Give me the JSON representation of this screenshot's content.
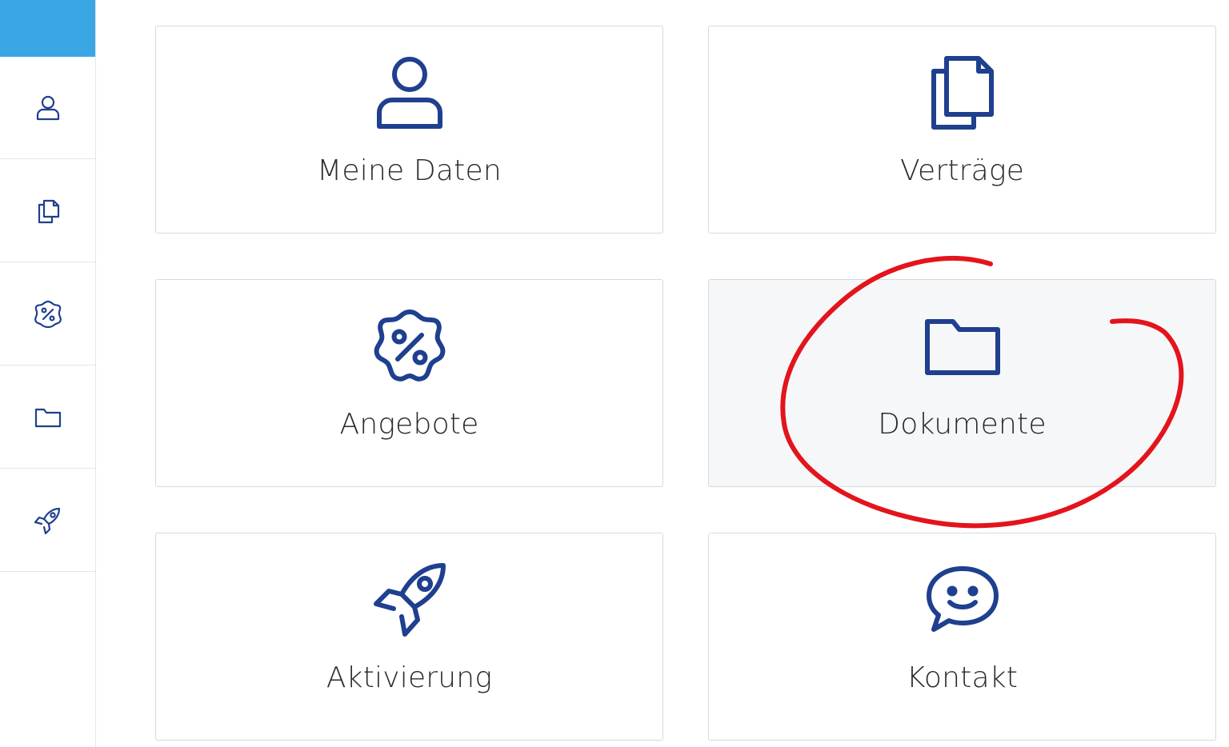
{
  "sidebar": {
    "items": [
      {
        "icon": "home-icon",
        "active": true
      },
      {
        "icon": "user-icon",
        "active": false
      },
      {
        "icon": "documents-copy-icon",
        "active": false
      },
      {
        "icon": "percent-badge-icon",
        "active": false
      },
      {
        "icon": "folder-icon",
        "active": false
      },
      {
        "icon": "rocket-icon",
        "active": false
      }
    ]
  },
  "tiles": {
    "meine_daten": {
      "label": "Meine Daten",
      "icon": "user-icon"
    },
    "vertraege": {
      "label": "Verträge",
      "icon": "documents-copy-icon"
    },
    "angebote": {
      "label": "Angebote",
      "icon": "percent-badge-icon"
    },
    "dokumente": {
      "label": "Dokumente",
      "icon": "folder-icon"
    },
    "aktivierung": {
      "label": "Aktivierung",
      "icon": "rocket-icon"
    },
    "kontakt": {
      "label": "Kontakt",
      "icon": "chat-smile-icon"
    }
  },
  "colors": {
    "icon_blue": "#1f3f8f",
    "active_blue": "#3aa6e3",
    "annotation_red": "#e3141c",
    "border": "#d6d9dd"
  }
}
